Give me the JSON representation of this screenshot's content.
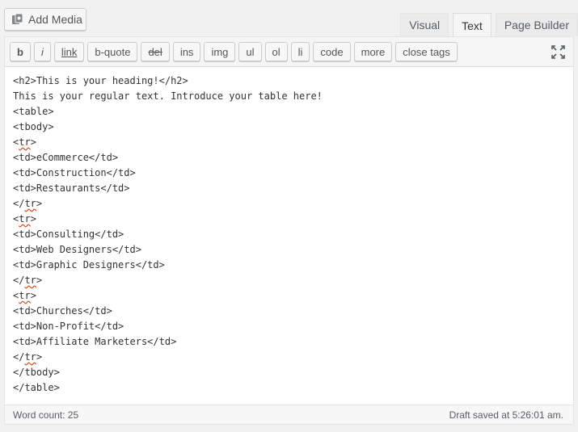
{
  "add_media": {
    "label": "Add Media",
    "icon": "media-icon"
  },
  "tabs": [
    {
      "label": "Visual",
      "active": false
    },
    {
      "label": "Text",
      "active": true
    },
    {
      "label": "Page Builder",
      "active": false
    }
  ],
  "toolbar": {
    "buttons": [
      "b",
      "i",
      "link",
      "b-quote",
      "del",
      "ins",
      "img",
      "ul",
      "ol",
      "li",
      "code",
      "more",
      "close tags"
    ],
    "fullscreen_icon": "fullscreen-icon"
  },
  "content": {
    "lines": [
      "<h2>This is your heading!</h2>",
      "This is your regular text. Introduce your table here!",
      "<table>",
      "<tbody>",
      "<tr>",
      "<td>eCommerce</td>",
      "<td>Construction</td>",
      "<td>Restaurants</td>",
      "</tr>",
      "<tr>",
      "<td>Consulting</td>",
      "<td>Web Designers</td>",
      "<td>Graphic Designers</td>",
      "</tr>",
      "<tr>",
      "<td>Churches</td>",
      "<td>Non-Profit</td>",
      "<td>Affiliate Marketers</td>",
      "</tr>",
      "</tbody>",
      "</table>"
    ]
  },
  "status": {
    "word_count": "Word count: 25",
    "draft_saved": "Draft saved at 5:26:01 am."
  }
}
